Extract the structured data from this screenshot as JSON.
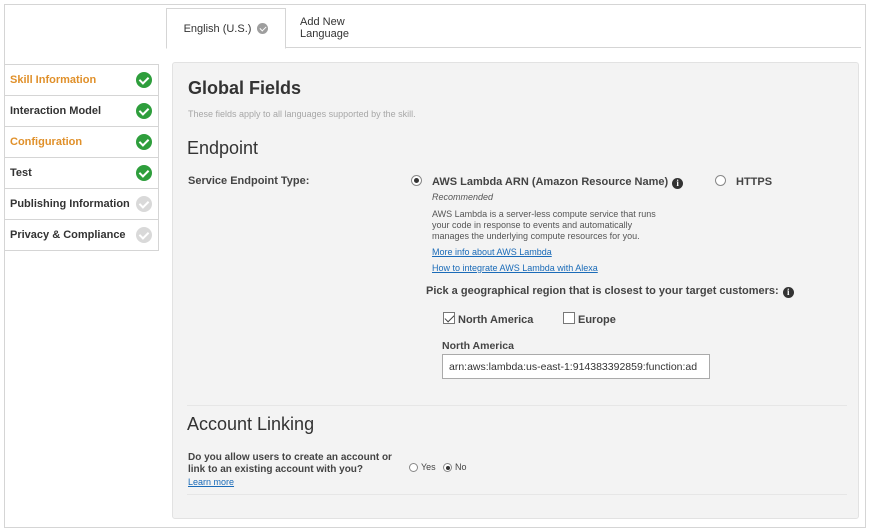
{
  "tabs": [
    {
      "label": "English (U.S.)",
      "active": true,
      "status": "done"
    },
    {
      "label": "Add New Language",
      "active": false
    }
  ],
  "sidebar": {
    "items": [
      {
        "label": "Skill Information",
        "color": "orange",
        "status": "done"
      },
      {
        "label": "Interaction Model",
        "color": "default",
        "status": "done"
      },
      {
        "label": "Configuration",
        "color": "orange",
        "status": "done"
      },
      {
        "label": "Test",
        "color": "default",
        "status": "done"
      },
      {
        "label": "Publishing Information",
        "color": "default",
        "status": "pending"
      },
      {
        "label": "Privacy & Compliance",
        "color": "default",
        "status": "pending"
      }
    ]
  },
  "global": {
    "title": "Global Fields",
    "subtitle": "These fields apply to all languages supported by the skill."
  },
  "endpoint": {
    "section_title": "Endpoint",
    "type_label": "Service Endpoint Type:",
    "lambda_option": "AWS Lambda ARN (Amazon Resource Name)",
    "lambda_selected": true,
    "recommended": "Recommended",
    "description_lines": [
      "AWS Lambda is a server-less compute service that runs",
      "your code in response to events and automatically",
      "manages the underlying compute resources for you."
    ],
    "link_more_info": "More info about AWS Lambda",
    "link_integrate": "How to integrate AWS Lambda with Alexa",
    "https_option": "HTTPS",
    "https_selected": false,
    "region_prompt": "Pick a geographical region that is closest to your target customers:",
    "region_north_america": "North America",
    "region_north_america_checked": true,
    "region_europe": "Europe",
    "region_europe_checked": false,
    "arn_label": "North America",
    "arn_value": "arn:aws:lambda:us-east-1:914383392859:function:ad"
  },
  "account_linking": {
    "section_title": "Account Linking",
    "question_line1": "Do you allow users to create an account or",
    "question_line2": "link to an existing account with you?",
    "learn_more": "Learn more",
    "yes_label": "Yes",
    "no_label": "No",
    "selected": "No"
  },
  "colors": {
    "orange_accent": "#e0902a",
    "done_green": "#2e9e3c",
    "pending_gray": "#d9d9d9",
    "link_blue": "#1a6bb8"
  },
  "icons": {
    "status_done": "check-circle-green-icon",
    "status_pending": "check-circle-gray-icon",
    "info": "info-icon"
  }
}
